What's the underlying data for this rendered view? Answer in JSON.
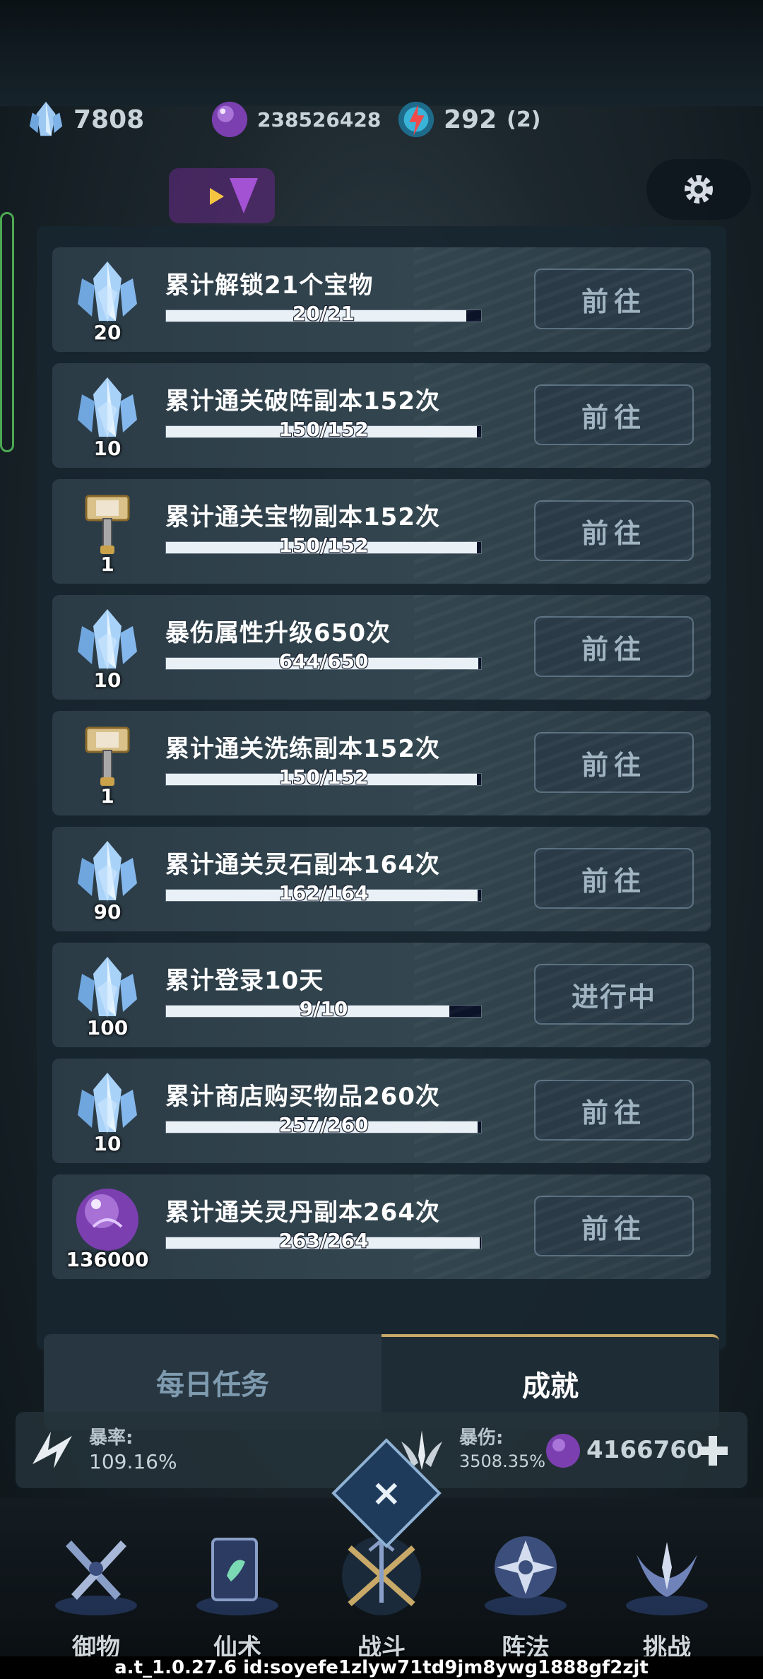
{
  "currencies": [
    {
      "icon": "crystal-icon",
      "value": "7808"
    },
    {
      "icon": "spirit-orb-icon",
      "value": "238526428"
    },
    {
      "icon": "energy-icon",
      "value": "292",
      "sub": "(2)"
    }
  ],
  "achievements": [
    {
      "title": "累计解锁21个宝物",
      "progress_text": "20/21",
      "current": 20,
      "total": 21,
      "reward_icon": "crystal-icon",
      "reward_count": "20",
      "button": "前往"
    },
    {
      "title": "累计通关破阵副本152次",
      "progress_text": "150/152",
      "current": 150,
      "total": 152,
      "reward_icon": "crystal-icon",
      "reward_count": "10",
      "button": "前往"
    },
    {
      "title": "累计通关宝物副本152次",
      "progress_text": "150/152",
      "current": 150,
      "total": 152,
      "reward_icon": "hammer-icon",
      "reward_count": "1",
      "button": "前往"
    },
    {
      "title": "暴伤属性升级650次",
      "progress_text": "644/650",
      "current": 644,
      "total": 650,
      "reward_icon": "crystal-icon",
      "reward_count": "10",
      "button": "前往"
    },
    {
      "title": "累计通关洗练副本152次",
      "progress_text": "150/152",
      "current": 150,
      "total": 152,
      "reward_icon": "hammer-icon",
      "reward_count": "1",
      "button": "前往"
    },
    {
      "title": "累计通关灵石副本164次",
      "progress_text": "162/164",
      "current": 162,
      "total": 164,
      "reward_icon": "crystal-icon",
      "reward_count": "90",
      "button": "前往"
    },
    {
      "title": "累计登录10天",
      "progress_text": "9/10",
      "current": 9,
      "total": 10,
      "reward_icon": "crystal-icon",
      "reward_count": "100",
      "button": "进行中"
    },
    {
      "title": "累计商店购买物品260次",
      "progress_text": "257/260",
      "current": 257,
      "total": 260,
      "reward_icon": "crystal-icon",
      "reward_count": "10",
      "button": "前往"
    },
    {
      "title": "累计通关灵丹副本264次",
      "progress_text": "263/264",
      "current": 263,
      "total": 264,
      "reward_icon": "spirit-orb-icon",
      "reward_count": "136000",
      "button": "前往"
    }
  ],
  "tabs": {
    "daily": "每日任务",
    "achievements": "成就"
  },
  "stats": {
    "crit_rate_label": "暴率:",
    "crit_rate_value": "109.16%",
    "crit_dmg_label": "暴伤:",
    "crit_dmg_value": "3508.35%",
    "orb_value": "4166760"
  },
  "close_symbol": "×",
  "nav": [
    "御物",
    "仙术",
    "战斗",
    "阵法",
    "挑战"
  ],
  "version": "a.t_1.0.27.6 id:soyefe1zlyw71td9jm8ywg1888gf2zjt",
  "colors": {
    "accent_gold": "#c8a968",
    "button_text": "#9fb3c0",
    "inactive_tab_text": "#7f9bb0"
  }
}
